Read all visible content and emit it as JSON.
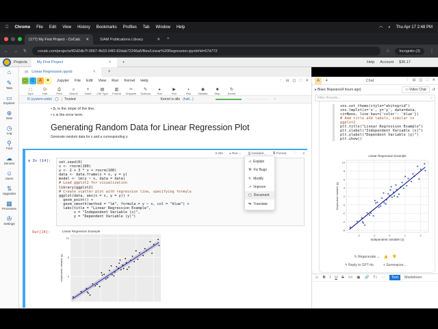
{
  "macos": {
    "app": "Chrome",
    "menus": [
      "File",
      "Edit",
      "View",
      "History",
      "Bookmarks",
      "Profiles",
      "Tab",
      "Window",
      "Help"
    ],
    "datetime": "Thu Apr 17  2:48 PM"
  },
  "browser": {
    "tabs": [
      {
        "label": "(177) My First Project - CoCalc"
      },
      {
        "label": "SIAM Publications Library"
      }
    ],
    "url": "cocalc.com/projects/82d2db7f-0967-4b33-94f2-82dab72246a5/files/Linear%20Regression.ipynb#id=67d772",
    "incognito": "Incognito (3)"
  },
  "cocalc": {
    "projects": "Projects",
    "project_tab": "My First Project",
    "help": "Help",
    "account": "Account",
    "balance": "$36.17"
  },
  "sidebar": {
    "items": [
      "Tabs",
      "Explorer",
      "New",
      "Log",
      "Find",
      "Servers",
      "Users",
      "Upgrades",
      "Processes",
      "Settings"
    ]
  },
  "file_tab": "Linear Regression.ipynb",
  "jupyter": {
    "label": "Jupyter",
    "menus": [
      "File",
      "Edit",
      "View",
      "Run",
      "Kernel",
      "Help"
    ],
    "tools": [
      "Type",
      "Halt",
      "Print",
      "Search",
      "Insert",
      "Cell Type",
      "Format",
      "Snippets",
      "Toolbars",
      "Run",
      "Run",
      "Run",
      "Validate",
      "Stop",
      "Kernel"
    ]
  },
  "status": {
    "kernel": "R (system-wide)",
    "trusted": "Trusted",
    "idle": "Kernel is idle",
    "halt": "(halt...)"
  },
  "markdown": {
    "bullets": [
      "β₁ is the slope of the line.",
      "ε is the error term."
    ],
    "heading": "Generating Random Data for Linear Regression Plot",
    "text": "Generate random data for x and a corresponding y:"
  },
  "cell": {
    "in_prompt": "In [14]:",
    "out_prompt": "Out[14]:",
    "time": "0.26s",
    "run": "Run",
    "assistant": "Assistant",
    "format": "Format",
    "count": "2",
    "code": [
      "set.seed(0)",
      "x <- rnorm(100)",
      "y <- 2 + 3 * x + rnorm(100)",
      "data <- data.frame(x = x, y = y)",
      "model <- lm(y ~ x, data = data)",
      "",
      "# Load ggplot2 for visualization",
      "library(ggplot2)",
      "",
      "# Create scatter plot with regression line, specifying formula",
      "ggplot(data, aes(x = x, y = y)) +",
      "  geom_point() +",
      "  geom_smooth(method = \"lm\", formula = y ~ x, col = \"blue\") +",
      "  labs(title = \"Linear Regression Example\",",
      "       x = \"Independent Variable (x)\",",
      "       y = \"Dependent Variable (y)\")"
    ]
  },
  "assistant_menu": [
    "Explain",
    "Fix Bugs",
    "Modify",
    "Improve",
    "Document",
    "Translate"
  ],
  "chat": {
    "title": "Chat",
    "thread": "Blaec Bejarano(4 hours ago)",
    "video": "Video Chat",
    "filter_placeholder": "Filter threads...",
    "code": [
      "sns.set_theme(style=\"whitegrid\")",
      "sns.lmplot(x='x', y='y', data=data,",
      "ci=None, line_kws={'color': 'blue'})",
      "",
      "# Add title and labels, similar to",
      "ggplot2",
      "plt.title(\"Linear Regression Example\")",
      "plt.xlabel(\"Independent Variable (x)\")",
      "plt.ylabel(\"Dependent Variable (y)\")",
      "",
      "plt.show()"
    ],
    "regenerate": "Regenerate",
    "reply": "Reply to GPT-4o",
    "summarize": "Summarize...",
    "fmt_text": "Text",
    "fmt_markdown": "Markdown"
  },
  "chart_data": [
    {
      "type": "scatter",
      "title": "Linear Regression Example",
      "xlabel": "Independent Variable (x)",
      "ylabel": "Dependent Variable (y)",
      "style": "ggplot",
      "yticks": [
        0,
        5,
        10
      ],
      "xlim": [
        -2.7,
        2.4
      ],
      "ylim": [
        -6.5,
        11
      ],
      "fit": {
        "intercept": 2,
        "slope": 3
      }
    },
    {
      "type": "scatter",
      "title": "Linear Regression Example",
      "xlabel": "Independent Variable (x)",
      "ylabel": "Dependent Variable (y)",
      "style": "whitegrid",
      "xticks": [
        -2,
        -1,
        0,
        1,
        2
      ],
      "yticks": [
        -6,
        -4,
        -2,
        0,
        2,
        4,
        6,
        8,
        10
      ],
      "xlim": [
        -2.8,
        2.5
      ],
      "ylim": [
        -6.5,
        10.5
      ],
      "fit": {
        "intercept": 2,
        "slope": 3
      }
    }
  ],
  "points": [
    [
      -2.55,
      -5.3
    ],
    [
      -2.1,
      -3.9
    ],
    [
      -1.8,
      -3.1
    ],
    [
      -1.75,
      -4.0
    ],
    [
      -1.7,
      -4.3
    ],
    [
      -1.6,
      -4.8
    ],
    [
      -1.45,
      -1.9
    ],
    [
      -1.3,
      -2.4
    ],
    [
      -1.2,
      -2.0
    ],
    [
      -1.05,
      -2.6
    ],
    [
      -0.95,
      1.0
    ],
    [
      -0.9,
      0.4
    ],
    [
      -0.8,
      0.6
    ],
    [
      -0.7,
      -0.6
    ],
    [
      -0.6,
      -0.3
    ],
    [
      -0.5,
      1.6
    ],
    [
      -0.4,
      2.8
    ],
    [
      -0.35,
      0.5
    ],
    [
      -0.25,
      0.2
    ],
    [
      -0.2,
      1.2
    ],
    [
      -0.1,
      2.6
    ],
    [
      0.0,
      2.2
    ],
    [
      0.05,
      3.5
    ],
    [
      0.1,
      4.3
    ],
    [
      0.15,
      1.8
    ],
    [
      0.25,
      3.0
    ],
    [
      0.3,
      2.1
    ],
    [
      0.4,
      4.7
    ],
    [
      0.45,
      3.6
    ],
    [
      0.5,
      1.9
    ],
    [
      0.6,
      2.5
    ],
    [
      0.7,
      4.2
    ],
    [
      0.8,
      5.3
    ],
    [
      0.9,
      3.9
    ],
    [
      1.0,
      6.7
    ],
    [
      1.1,
      4.5
    ],
    [
      1.2,
      6.2
    ],
    [
      1.4,
      5.5
    ],
    [
      1.5,
      7.3
    ],
    [
      1.6,
      6.8
    ],
    [
      1.8,
      9.1
    ],
    [
      1.9,
      6.1
    ],
    [
      2.0,
      8.4
    ],
    [
      2.25,
      9.7
    ],
    [
      2.3,
      8.1
    ]
  ]
}
